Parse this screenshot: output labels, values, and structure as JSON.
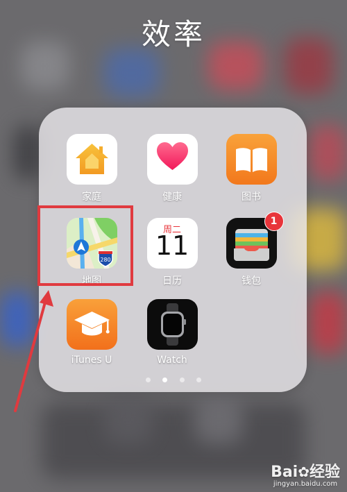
{
  "folder": {
    "title": "效率",
    "apps": [
      {
        "id": "home",
        "label": "家庭",
        "icon": "home-icon"
      },
      {
        "id": "health",
        "label": "健康",
        "icon": "heart-icon"
      },
      {
        "id": "books",
        "label": "图书",
        "icon": "book-icon"
      },
      {
        "id": "maps",
        "label": "地图",
        "icon": "map-icon",
        "route_label": "280"
      },
      {
        "id": "calendar",
        "label": "日历",
        "icon": "calendar-icon",
        "weekday": "周二",
        "day": "11"
      },
      {
        "id": "wallet",
        "label": "钱包",
        "icon": "wallet-icon",
        "badge": "1"
      },
      {
        "id": "itunesu",
        "label": "iTunes U",
        "icon": "graduation-cap-icon"
      },
      {
        "id": "watch",
        "label": "Watch",
        "icon": "watch-icon"
      }
    ],
    "pages": {
      "count": 4,
      "active": 2
    }
  },
  "annotation": {
    "color": "#e03a3f",
    "target": "地图"
  },
  "watermark": {
    "logo": "Bai度经验",
    "site": "jingyan.baidu.com"
  },
  "colors": {
    "accent_red": "#e8343a",
    "folder_bg": "#eceaee"
  }
}
